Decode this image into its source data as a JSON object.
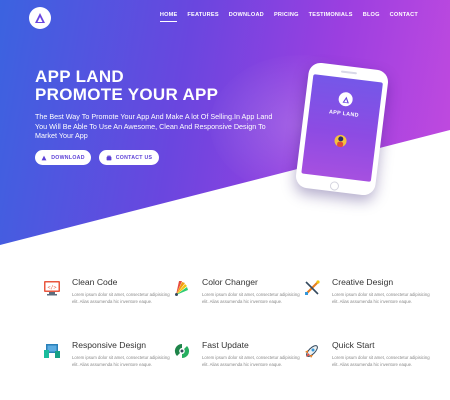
{
  "nav": {
    "items": [
      {
        "label": "HOME",
        "active": true
      },
      {
        "label": "FEATURES",
        "active": false
      },
      {
        "label": "DOWNLOAD",
        "active": false
      },
      {
        "label": "PRICING",
        "active": false
      },
      {
        "label": "TESTIMONIALS",
        "active": false
      },
      {
        "label": "BLOG",
        "active": false
      },
      {
        "label": "CONTACT",
        "active": false
      }
    ]
  },
  "hero": {
    "title_line1": "APP LAND",
    "title_line2": "PROMOTE YOUR APP",
    "description": "The Best Way To Promote Your App And Make A lot Of Selling.In App Land You Will Be Able To Use An Awesome, Clean And Responsive Design To Market Your App",
    "download_label": "DOWNLOAD",
    "contact_label": "CONTACT US",
    "download_icon": "android-icon",
    "contact_icon": "phone-icon"
  },
  "phone": {
    "app_title": "APP LAND"
  },
  "features": [
    {
      "title": "Clean Code",
      "description": "Lorem ipsum dolor sit amet, consectetur adipisicing elit. Alias assumenda hic inventore eaque.",
      "icon": "code-monitor-icon"
    },
    {
      "title": "Color Changer",
      "description": "Lorem ipsum dolor sit amet, consectetur adipisicing elit. Alias assumenda hic inventore eaque.",
      "icon": "color-palette-icon"
    },
    {
      "title": "Creative Design",
      "description": "Lorem ipsum dolor sit amet, consectetur adipisicing elit. Alias assumenda hic inventore eaque.",
      "icon": "design-tools-icon"
    },
    {
      "title": "Responsive Design",
      "description": "Lorem ipsum dolor sit amet, consectetur adipisicing elit. Alias assumenda hic inventore eaque.",
      "icon": "devices-icon"
    },
    {
      "title": "Fast Update",
      "description": "Lorem ipsum dolor sit amet, consectetur adipisicing elit. Alias assumenda hic inventore eaque.",
      "icon": "update-icon"
    },
    {
      "title": "Quick Start",
      "description": "Lorem ipsum dolor sit amet, consectetur adipisicing elit. Alias assumenda hic inventore eaque.",
      "icon": "rocket-icon"
    }
  ],
  "colors": {
    "gradient_start": "#3b63e0",
    "gradient_end": "#c44bdf",
    "accent": "#5b3fd6"
  }
}
